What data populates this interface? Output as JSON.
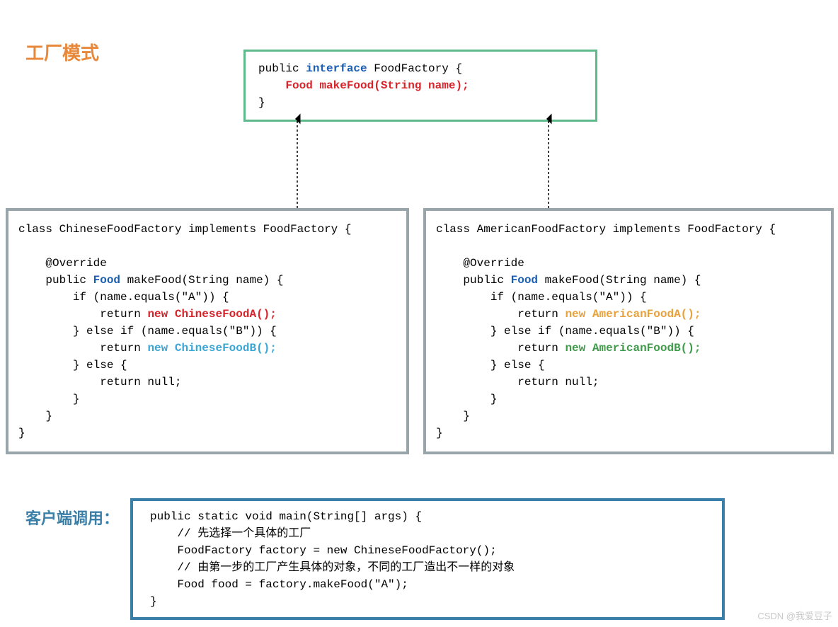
{
  "title": "工厂模式",
  "clientTitle": "客户端调用：",
  "watermark": "CSDN @我爱豆子",
  "iface": {
    "l1a": "public ",
    "l1b": "interface",
    "l1c": " FoodFactory {",
    "l2a": "    ",
    "l2b": "Food makeFood(String name);",
    "l3": "}"
  },
  "chinese": {
    "l1": "class ChineseFoodFactory implements FoodFactory {",
    "blank": "",
    "l3": "    @Override",
    "l4a": "    public ",
    "l4b": "Food",
    "l4c": " makeFood(String name) {",
    "l5": "        if (name.equals(\"A\")) {",
    "l6a": "            return ",
    "l6b": "new",
    "l6c": " ",
    "l6d": "ChineseFoodA();",
    "l7": "        } else if (name.equals(\"B\")) {",
    "l8a": "            return ",
    "l8b": "new",
    "l8c": " ",
    "l8d": "ChineseFoodB();",
    "l9": "        } else {",
    "l10": "            return null;",
    "l11": "        }",
    "l12": "    }",
    "l13": "}"
  },
  "american": {
    "l1": "class AmericanFoodFactory implements FoodFactory {",
    "blank": "",
    "l3": "    @Override",
    "l4a": "    public ",
    "l4b": "Food",
    "l4c": " makeFood(String name) {",
    "l5": "        if (name.equals(\"A\")) {",
    "l6a": "            return ",
    "l6b": "new",
    "l6c": " ",
    "l6d": "AmericanFoodA();",
    "l7": "        } else if (name.equals(\"B\")) {",
    "l8a": "            return ",
    "l8b": "new",
    "l8c": " ",
    "l8d": "AmericanFoodB();",
    "l9": "        } else {",
    "l10": "            return null;",
    "l11": "        }",
    "l12": "    }",
    "l13": "}"
  },
  "client": {
    "l1": "public static void main(String[] args) {",
    "l2": "    // 先选择一个具体的工厂",
    "l3": "    FoodFactory factory = new ChineseFoodFactory();",
    "l4": "    // 由第一步的工厂产生具体的对象，不同的工厂造出不一样的对象",
    "l5": "    Food food = factory.makeFood(\"A\");",
    "l6": "}"
  }
}
